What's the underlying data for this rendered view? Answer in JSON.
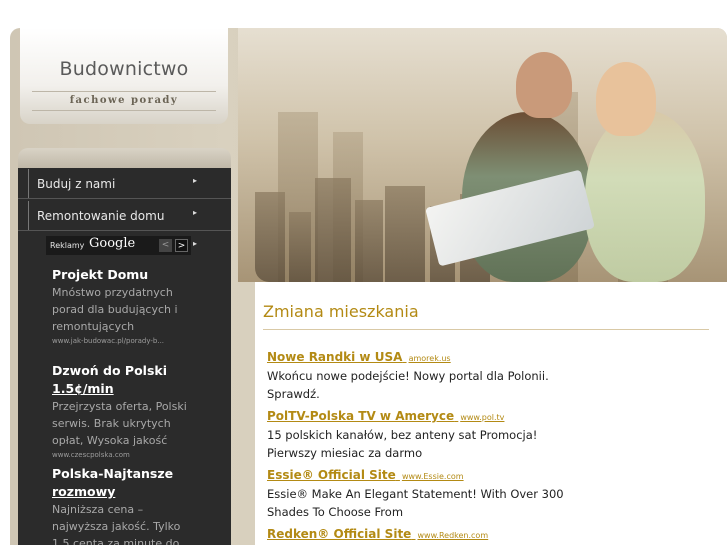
{
  "logo": {
    "title": "Budownictwo",
    "subtitle": "fachowe porady"
  },
  "nav": {
    "items": [
      {
        "label": "Buduj z nami"
      },
      {
        "label": "Remontowanie domu"
      }
    ]
  },
  "ads_panel": {
    "label": "Reklamy",
    "brand": "Google",
    "prev_glyph": "<",
    "next_glyph": ">",
    "ads": [
      {
        "title": "Projekt Domu",
        "title_link": "",
        "text": "Mnóstwo przydatnych porad dla budujących i remontujących",
        "url": "www.jak-budowac.pl/porady-b..."
      },
      {
        "title": "Dzwoń do Polski",
        "title_link": "1.5¢/min",
        "text": "Przejrzysta oferta, Polski serwis. Brak ukrytych opłat, Wysoka jakość",
        "url": "www.czescpolska.com"
      },
      {
        "title": "Polska-Najtansze",
        "title_link": "rozmowy",
        "text": "Najniższa cena – najwyższa jakość. Tylko 1.5 centa za minute do",
        "url": ""
      }
    ]
  },
  "main": {
    "heading": "Zmiana mieszkania",
    "results": [
      {
        "title": "Nowe Randki w USA",
        "url": "amorek.us",
        "text": "Wkońcu nowe podejście! Nowy portal dla Polonii. Sprawdź."
      },
      {
        "title": "PolTV-Polska TV w Ameryce",
        "url": "www.pol.tv",
        "text": "15 polskich kanałów, bez anteny sat Promocja! Pierwszy miesiac za darmo"
      },
      {
        "title": "Essie® Official Site",
        "url": "www.Essie.com",
        "text": "Essie® Make An Elegant Statement! With Over 300 Shades To Choose From"
      },
      {
        "title": "Redken® Official Site",
        "url": "www.Redken.com",
        "text": ""
      }
    ]
  },
  "colors": {
    "accent": "#b38a14",
    "sidebar": "#2b2b2b",
    "frame": "#cfc6b4"
  },
  "icons": {
    "nav_arrow": "chevron-right-icon",
    "ads_prev": "chevron-left-icon",
    "ads_next": "chevron-right-icon"
  }
}
